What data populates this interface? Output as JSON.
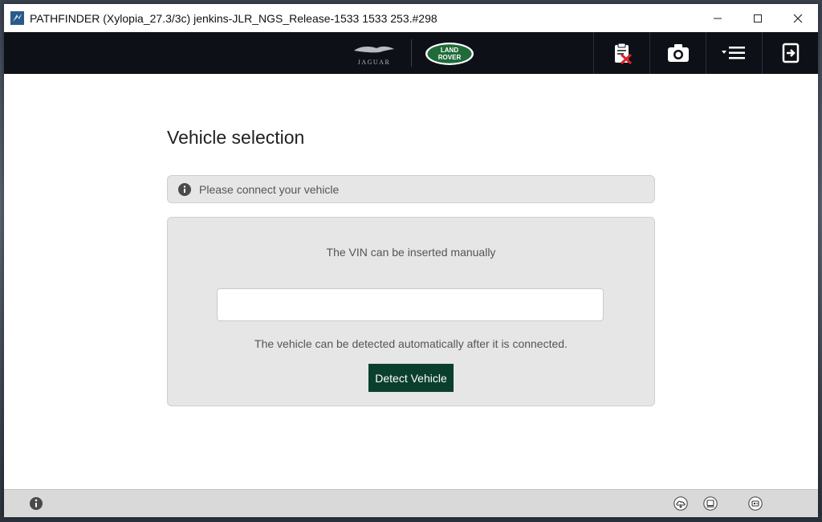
{
  "window": {
    "title": "PATHFINDER (Xylopia_27.3/3c) jenkins-JLR_NGS_Release-1533 1533 253.#298",
    "controls": [
      "minimize-icon",
      "maximize-icon",
      "close-icon"
    ]
  },
  "header": {
    "brand_jaguar": "JAGUAR",
    "brand_landrover_line1": "LAND",
    "brand_landrover_line2": "ROVER",
    "buttons": [
      "clipboard-cancel-icon",
      "camera-icon",
      "menu-icon",
      "exit-icon"
    ]
  },
  "main": {
    "title": "Vehicle selection",
    "info_message": "Please connect your vehicle",
    "vin_label": "The VIN can be inserted manually",
    "vin_value": "",
    "vin_placeholder": "",
    "auto_detect_text": "The vehicle can be detected automatically after it is connected.",
    "detect_button": "Detect Vehicle"
  },
  "footer": {
    "icons": [
      "info-icon",
      "cloud-icon",
      "device-icon",
      "vci-icon"
    ]
  },
  "colors": {
    "header_bg": "#0d1117",
    "detect_button_bg": "#0a3f2e",
    "panel_bg": "#e6e6e6",
    "landrover_green": "#1f6b3a"
  }
}
